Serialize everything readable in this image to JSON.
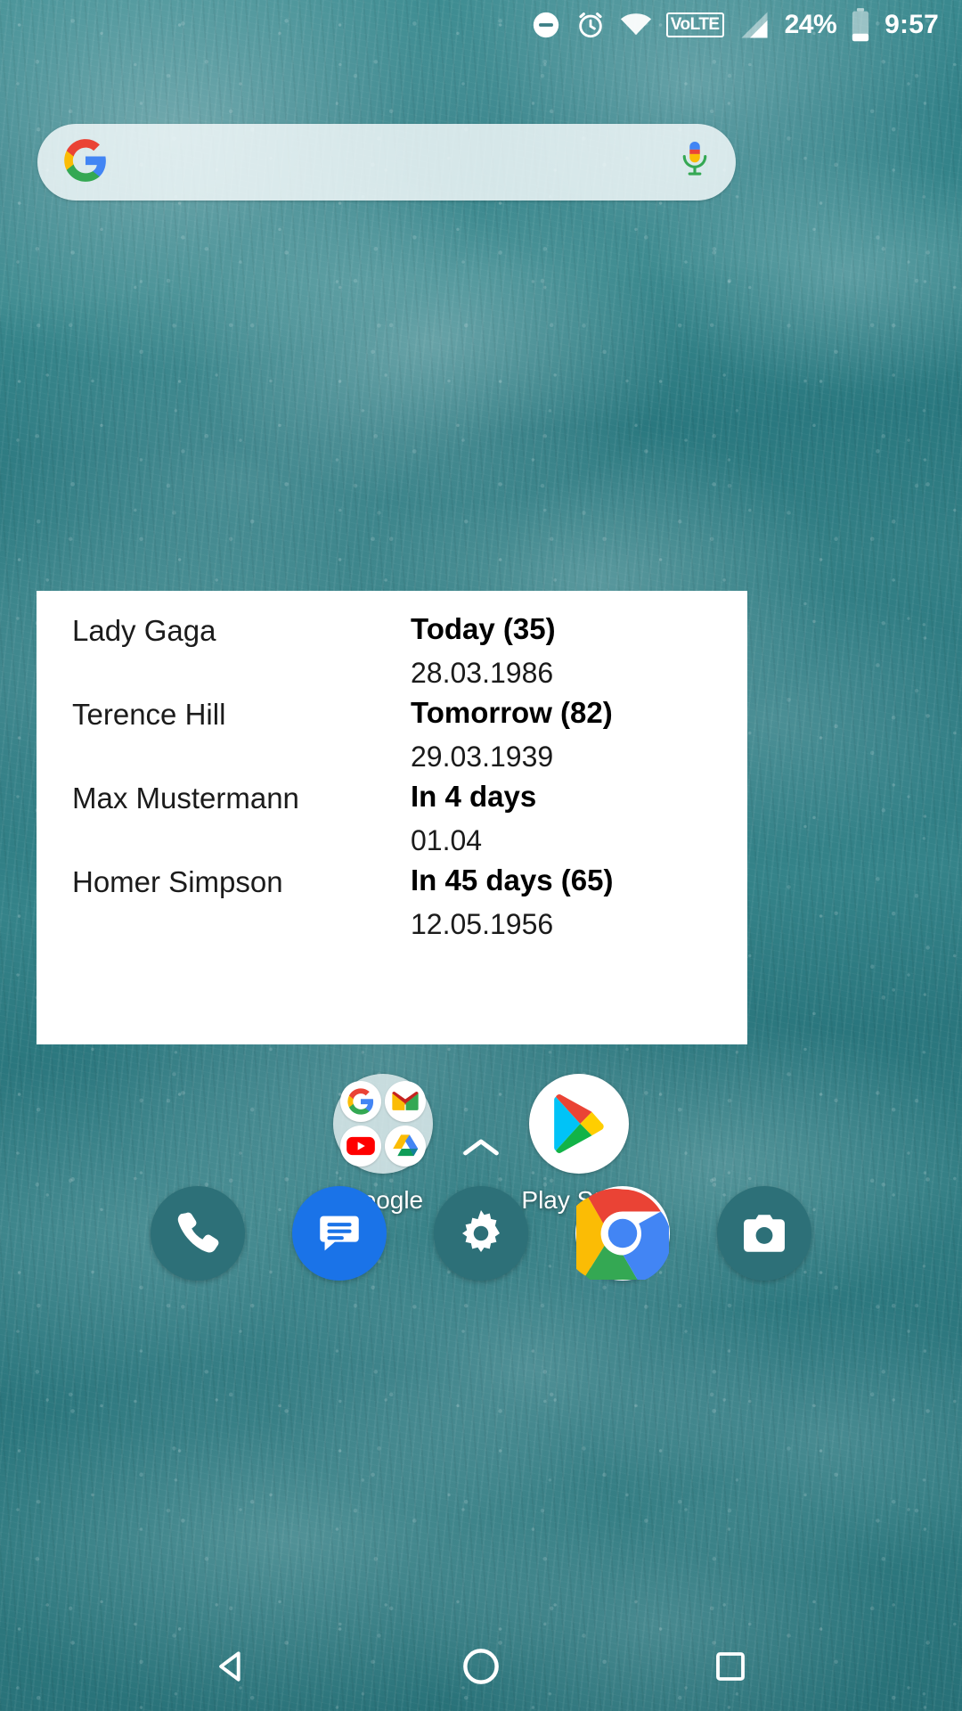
{
  "status_bar": {
    "dnd_icon": "do-not-disturb-icon",
    "alarm_icon": "alarm-clock-icon",
    "wifi_icon": "wifi-icon",
    "volte_label": "VoLTE",
    "signal_icon": "cellular-signal-icon",
    "battery_percent": "24%",
    "battery_icon": "battery-low-icon",
    "time": "9:57"
  },
  "search": {
    "google_logo": "google-g-icon",
    "placeholder": "",
    "value": "",
    "mic_icon": "microphone-icon"
  },
  "widget": {
    "name": "birthday-list-widget",
    "entries": [
      {
        "person": "Lady Gaga",
        "when": "Today (35)",
        "date": "28.03.1986"
      },
      {
        "person": "Terence Hill",
        "when": "Tomorrow (82)",
        "date": "29.03.1939"
      },
      {
        "person": "Max Mustermann",
        "when": "In 4 days",
        "date": "01.04"
      },
      {
        "person": "Homer Simpson",
        "when": "In 45 days (65)",
        "date": "12.05.1956"
      }
    ]
  },
  "home_apps": [
    {
      "label": "Google",
      "icon": "google-folder-icon",
      "type": "folder",
      "contents": [
        "google-search-icon",
        "gmail-icon",
        "youtube-icon",
        "google-drive-icon"
      ]
    },
    {
      "label": "Play Store",
      "icon": "play-store-icon",
      "type": "app",
      "contents": []
    }
  ],
  "drawer_handle": {
    "icon": "chevron-up-icon"
  },
  "dock": [
    {
      "label": "Phone",
      "icon": "phone-icon",
      "color": "#2d7078"
    },
    {
      "label": "Messages",
      "icon": "messages-icon",
      "color": "#1a73e8"
    },
    {
      "label": "Settings",
      "icon": "gear-icon",
      "color": "#2d7078"
    },
    {
      "label": "Chrome",
      "icon": "chrome-icon",
      "color": "#ffffff"
    },
    {
      "label": "Camera",
      "icon": "camera-icon",
      "color": "#2d7078"
    }
  ],
  "nav_bar": [
    {
      "label": "Back",
      "icon": "back-triangle-icon"
    },
    {
      "label": "Home",
      "icon": "home-circle-icon"
    },
    {
      "label": "Recents",
      "icon": "recents-square-icon"
    }
  ],
  "colors": {
    "widget_bg": "#ffffff",
    "widget_text": "#1b1b1b",
    "wallpaper_teal": "#2d7b82",
    "dock_teal": "#2d7078",
    "messages_blue": "#1a73e8"
  }
}
